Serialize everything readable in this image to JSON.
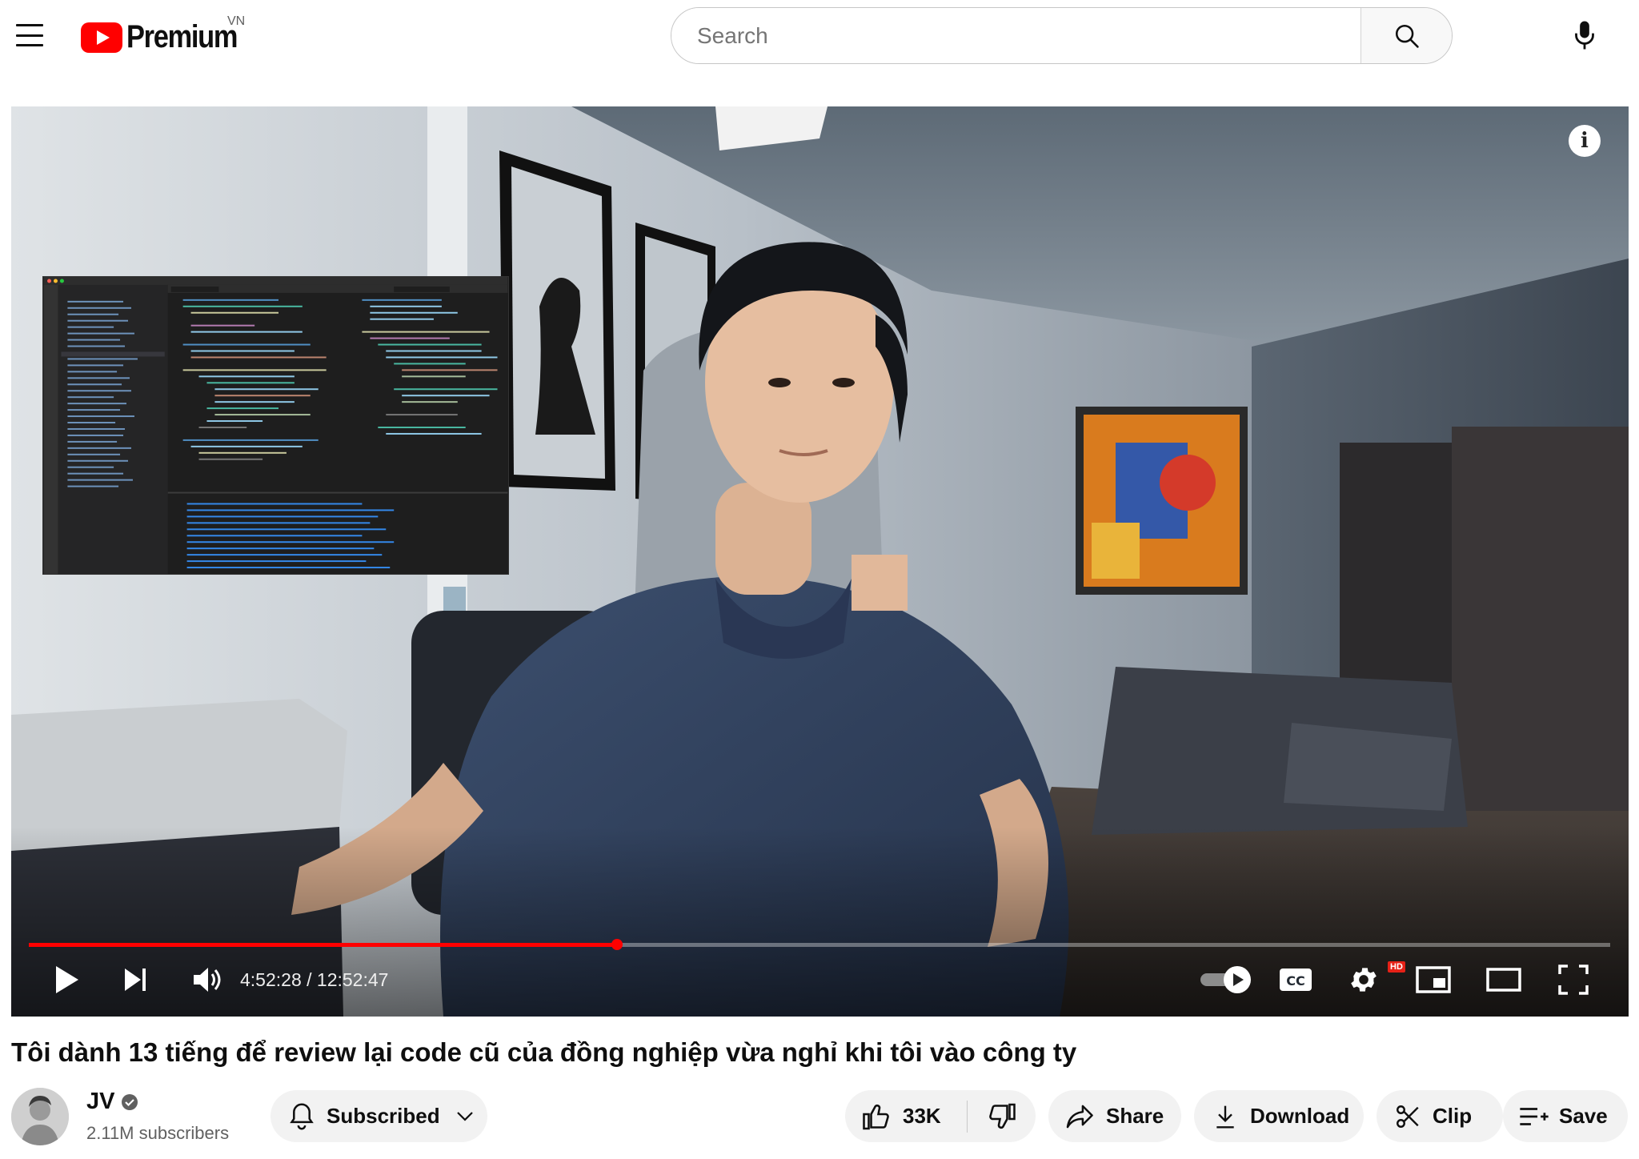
{
  "header": {
    "logo_text": "Premium",
    "region": "VN",
    "search_placeholder": "Search"
  },
  "player": {
    "current_time": "4:52:28",
    "duration": "12:52:47",
    "time_display": "4:52:28 / 12:52:47",
    "progress_fraction": 0.372,
    "quality_badge": "HD",
    "icons": [
      "info-icon",
      "play-icon",
      "next-icon",
      "volume-icon",
      "autoplay-toggle",
      "captions-icon",
      "settings-icon",
      "miniplayer-icon",
      "theater-icon",
      "fullscreen-icon"
    ],
    "colors": {
      "progress": "#ff0000",
      "background": "#232a33"
    }
  },
  "video": {
    "title": "Tôi dành 13 tiếng để review lại code cũ của đồng nghiệp vừa nghỉ khi tôi vào công ty",
    "channel": "JV",
    "subscribers": "2.11M subscribers",
    "verified": true
  },
  "actions": {
    "subscribe_label": "Subscribed",
    "like_count": "33K",
    "share_label": "Share",
    "download_label": "Download",
    "clip_label": "Clip",
    "save_label": "Save"
  }
}
